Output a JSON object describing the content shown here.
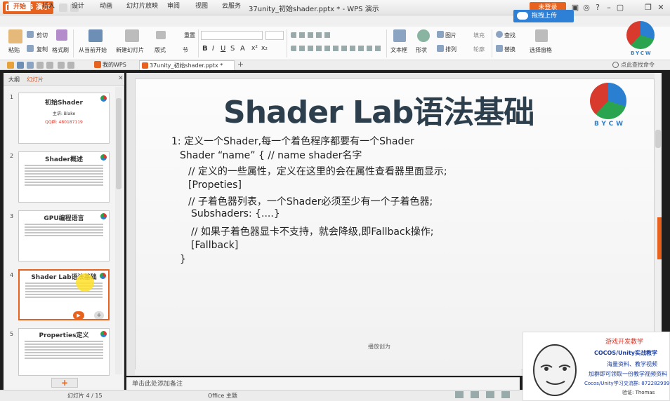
{
  "app": {
    "menu_label": "WPS 演示",
    "window_title": "37unity_初始shader.pptx * - WPS 演示",
    "login_label": "未登录",
    "upload_label": "拖拽上传"
  },
  "tabs": [
    "开始",
    "插入",
    "设计",
    "动画",
    "幻灯片放映",
    "审阅",
    "视图",
    "云服务"
  ],
  "ribbon": {
    "paste": "粘贴",
    "cut": "剪切",
    "copy": "复制",
    "format_painter": "格式刷",
    "from_current": "从当前开始",
    "new_slide": "新建幻灯片",
    "layout": "版式",
    "section": "节",
    "reset": "重置",
    "textbox": "文本框",
    "shape": "形状",
    "arrange": "排列",
    "picture": "图片",
    "fill": "填充",
    "outline": "轮廓",
    "find": "查找",
    "replace": "替换",
    "select_pane": "选择窗格"
  },
  "quickbar": {
    "my_wps": "我的WPS",
    "doc_tab": "37unity_初始shader.pptx *",
    "search_placeholder": "点此查找命令"
  },
  "panel": {
    "tab_outline": "大纲",
    "tab_slides": "幻灯片"
  },
  "thumbnails": [
    {
      "num": "1",
      "title": "初始Shader",
      "sub1": "主讲: Blake",
      "sub2": "QQ群: 480187119"
    },
    {
      "num": "2",
      "title": "Shader概述"
    },
    {
      "num": "3",
      "title": "GPU编程语言"
    },
    {
      "num": "4",
      "title": "Shader Lab语法基础"
    },
    {
      "num": "5",
      "title": "Properties定义"
    }
  ],
  "slide": {
    "title": "Shader Lab语法基础",
    "logo_text": "BYCW",
    "lines": [
      "1: 定义一个Shader,每一个着色程序都要有一个Shader",
      "Shader “name” { // name shader名字",
      "// 定义的一些属性，定义在这里的会在属性查看器里面显示;",
      "[Propeties]",
      "// 子着色器列表，一个Shader必须至少有一个子着色器;",
      "Subshaders: {....}",
      "// 如果子着色器显卡不支持，就会降级,即Fallback操作;",
      "[Fallback]",
      "}"
    ],
    "footer": "播放创为"
  },
  "notes_placeholder": "单击此处添加备注",
  "status": {
    "slide_index": "幻灯片 4 / 15",
    "theme": "Office 主题"
  },
  "ad": {
    "line1": "游戏开发教学",
    "line2": "COCOS/Unity实战教学",
    "line3": "海量资料、教学视频",
    "line4": "加群即可领取一份教学视频资料",
    "line5": "Cocos/Unity学习交流群: 872282999",
    "line6": "验证: Thomas"
  },
  "colors": {
    "accent": "#e8621f",
    "upload": "#2e7fd6",
    "title_text": "#2d3f4d"
  }
}
